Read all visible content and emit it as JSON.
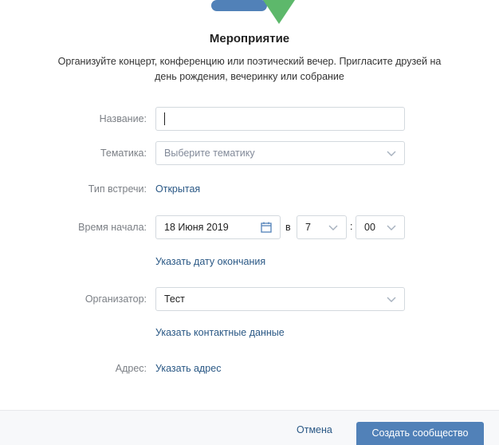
{
  "header": {
    "title": "Мероприятие",
    "description": "Организуйте концерт, конференцию или поэтический вечер. Пригласите друзей на день рождения, вечеринку или собрание"
  },
  "form": {
    "name": {
      "label": "Название:",
      "value": ""
    },
    "topic": {
      "label": "Тематика:",
      "placeholder": "Выберите тематику"
    },
    "meeting_type": {
      "label": "Тип встречи:",
      "value": "Открытая"
    },
    "start_time": {
      "label": "Время начала:",
      "date": "18 Июня 2019",
      "separator_in": "в",
      "hour": "7",
      "colon": ":",
      "minute": "00",
      "end_date_link": "Указать дату окончания"
    },
    "organizer": {
      "label": "Организатор:",
      "value": "Тест",
      "contacts_link": "Указать контактные данные"
    },
    "address": {
      "label": "Адрес:",
      "link": "Указать адрес"
    }
  },
  "footer": {
    "cancel_label": "Отмена",
    "create_label": "Создать сообщество"
  },
  "colors": {
    "link": "#2a5885",
    "primary_button": "#5181b8",
    "label": "#7b7f85",
    "border": "#d3d9de",
    "illustration_green": "#5db86b",
    "illustration_blue": "#5181b8"
  },
  "icons": [
    "calendar-icon",
    "chevron-down-icon"
  ]
}
